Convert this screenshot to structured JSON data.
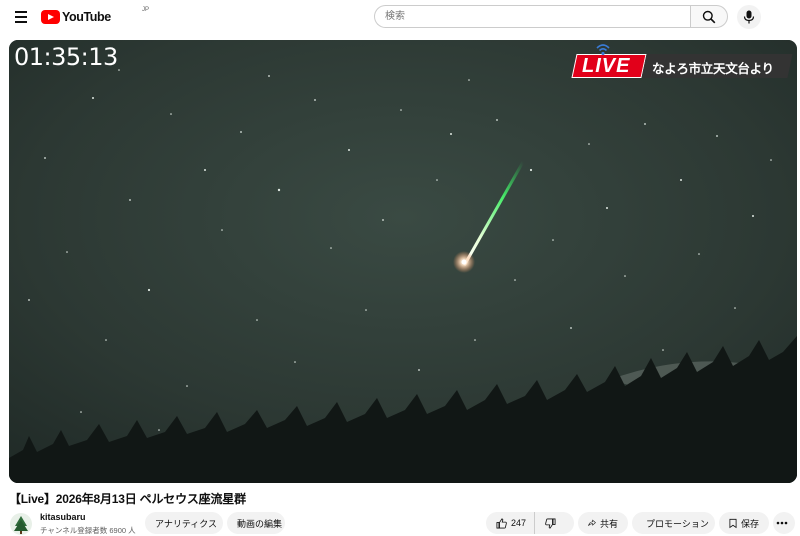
{
  "header": {
    "logo_text": "YouTube",
    "logo_region": "JP",
    "search_placeholder": "検索"
  },
  "player": {
    "timecode": "01:35:13",
    "live_label": "LIVE",
    "live_location": "なよろ市立天文台より",
    "live_color": "#e2001a"
  },
  "video": {
    "title": "【Live】2026年8月13日 ペルセウス座流星群"
  },
  "channel": {
    "name": "kitasubaru",
    "subscribers": "チャンネル登録者数 6900 人"
  },
  "actions": {
    "analytics": "アナリティクス",
    "edit_video": "動画の編集",
    "likes": "247",
    "share": "共有",
    "promotion": "プロモーション",
    "save": "保存"
  },
  "icons": [
    "menu-icon",
    "youtube-logo-icon",
    "search-icon",
    "mic-icon",
    "wifi-icon",
    "like-icon",
    "dislike-icon",
    "share-icon",
    "promotion-icon",
    "save-icon",
    "more-icon"
  ]
}
